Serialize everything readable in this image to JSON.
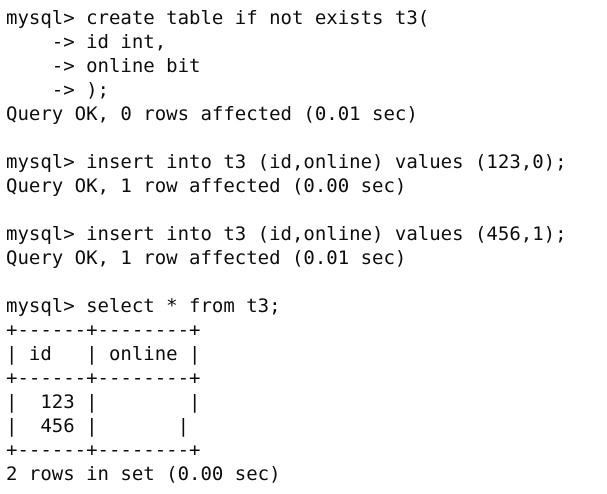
{
  "terminal": {
    "lines": [
      "mysql> create table if not exists t3(",
      "    -> id int,",
      "    -> online bit",
      "    -> );",
      "Query OK, 0 rows affected (0.01 sec)",
      "",
      "mysql> insert into t3 (id,online) values (123,0);",
      "Query OK, 1 row affected (0.00 sec)",
      "",
      "mysql> insert into t3 (id,online) values (456,1);",
      "Query OK, 1 row affected (0.01 sec)",
      "",
      "mysql> select * from t3;",
      "+------+--------+",
      "| id   | online |",
      "+------+--------+",
      "|  123 |        |",
      "|  456 |       |",
      "+------+--------+",
      "2 rows in set (0.00 sec)"
    ]
  }
}
